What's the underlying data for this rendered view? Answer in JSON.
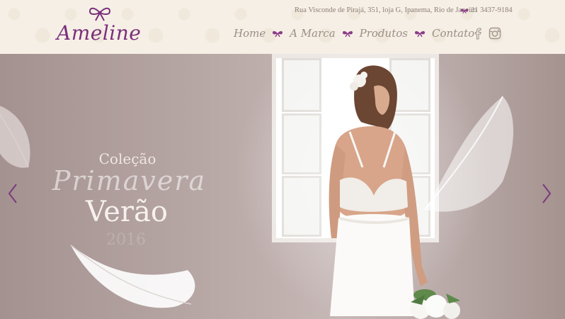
{
  "brand": {
    "name": "Ameline"
  },
  "contact": {
    "address": "Rua Visconde de Pirajá, 351, loja G, Ipanema, Rio de Janeiro",
    "phone": "21 3437-9184"
  },
  "nav": {
    "items": [
      {
        "label": "Home"
      },
      {
        "label": "A Marca"
      },
      {
        "label": "Produtos"
      },
      {
        "label": "Contato"
      }
    ]
  },
  "social": [
    "facebook-icon",
    "instagram-icon"
  ],
  "hero": {
    "line1": "Coleção",
    "line2": "Primavera",
    "line3": "Verão",
    "line4": "2016"
  },
  "colors": {
    "brand_purple": "#7a2f7b",
    "header_bg": "#f6efe6",
    "nav_text": "#9a8f86",
    "hero_bg": "#b6a6a4"
  }
}
